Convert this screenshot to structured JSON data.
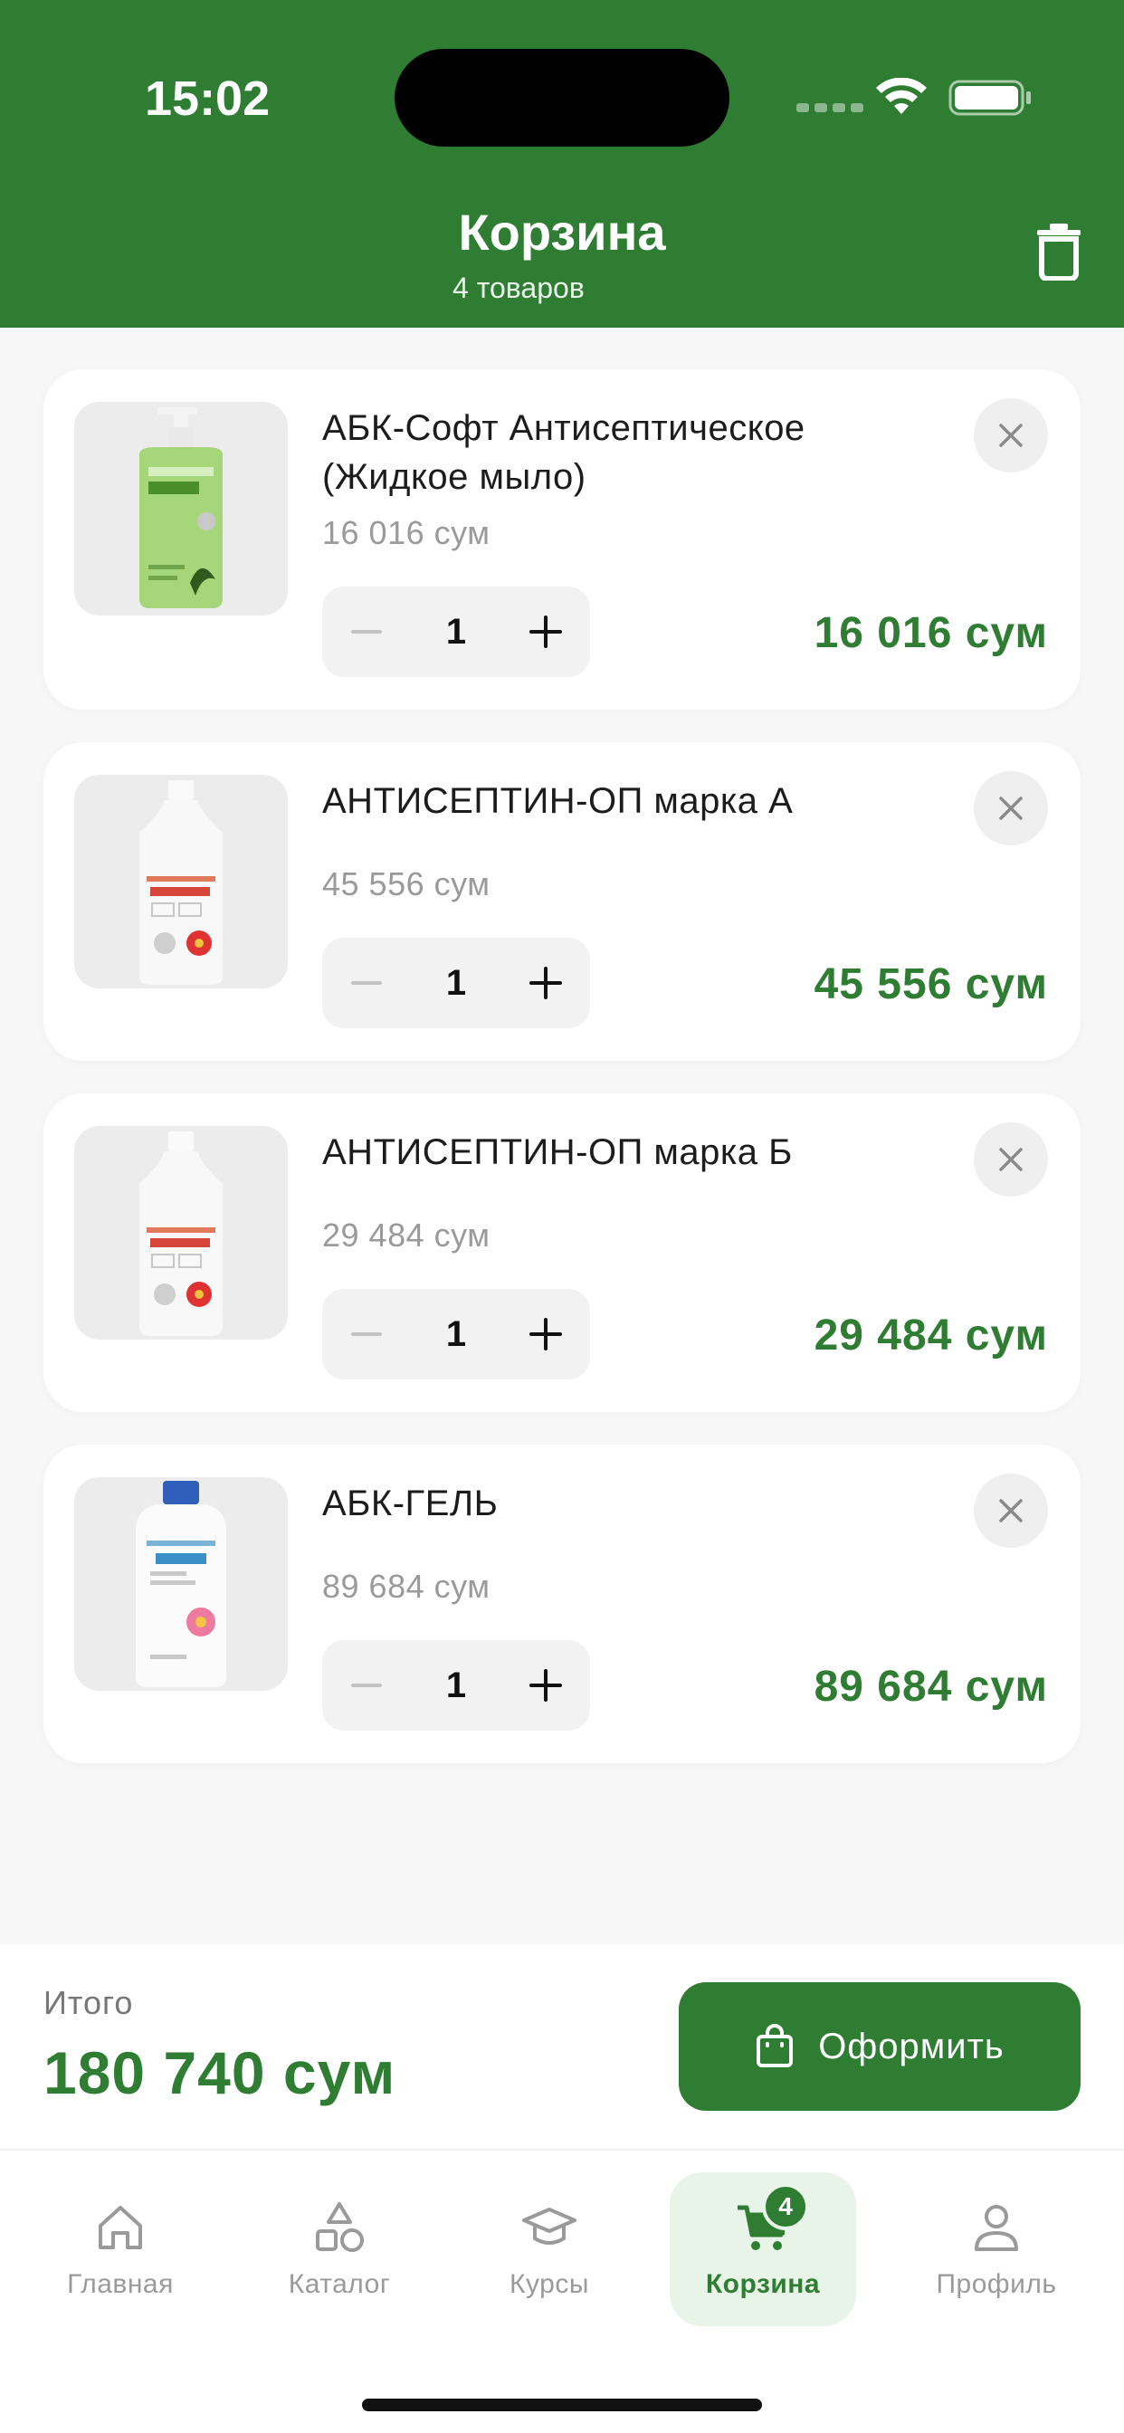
{
  "status_bar": {
    "time": "15:02"
  },
  "header": {
    "title": "Корзина",
    "subtitle": "4 товаров"
  },
  "items": [
    {
      "name": "АБК-Софт Антисептическое (Жидкое мыло)",
      "unit_price": "16 016 сум",
      "quantity": "1",
      "total": "16 016 сум",
      "image": "green-soap-pump-bottle"
    },
    {
      "name": "АНТИСЕПТИН-ОП марка А",
      "unit_price": "45 556 сум",
      "quantity": "1",
      "total": "45 556 сум",
      "image": "white-bottle-red-flower"
    },
    {
      "name": "АНТИСЕПТИН-ОП марка Б",
      "unit_price": "29 484 сум",
      "quantity": "1",
      "total": "29 484 сум",
      "image": "white-bottle-red-flower"
    },
    {
      "name": "АБК-ГЕЛЬ",
      "unit_price": "89 684 сум",
      "quantity": "1",
      "total": "89 684 сум",
      "image": "white-canister-blue-cap"
    }
  ],
  "summary": {
    "label": "Итого",
    "total": "180 740 сум",
    "checkout_label": "Оформить"
  },
  "tabbar": {
    "tabs": [
      {
        "label": "Главная",
        "icon": "home-icon"
      },
      {
        "label": "Каталог",
        "icon": "shapes-icon"
      },
      {
        "label": "Курсы",
        "icon": "graduation-cap-icon"
      },
      {
        "label": "Корзина",
        "icon": "cart-icon",
        "badge": "4",
        "active": true
      },
      {
        "label": "Профиль",
        "icon": "person-icon"
      }
    ]
  },
  "colors": {
    "brand": "#2e7d32",
    "muted": "#9a9a9a",
    "background": "#f7f7f7"
  }
}
